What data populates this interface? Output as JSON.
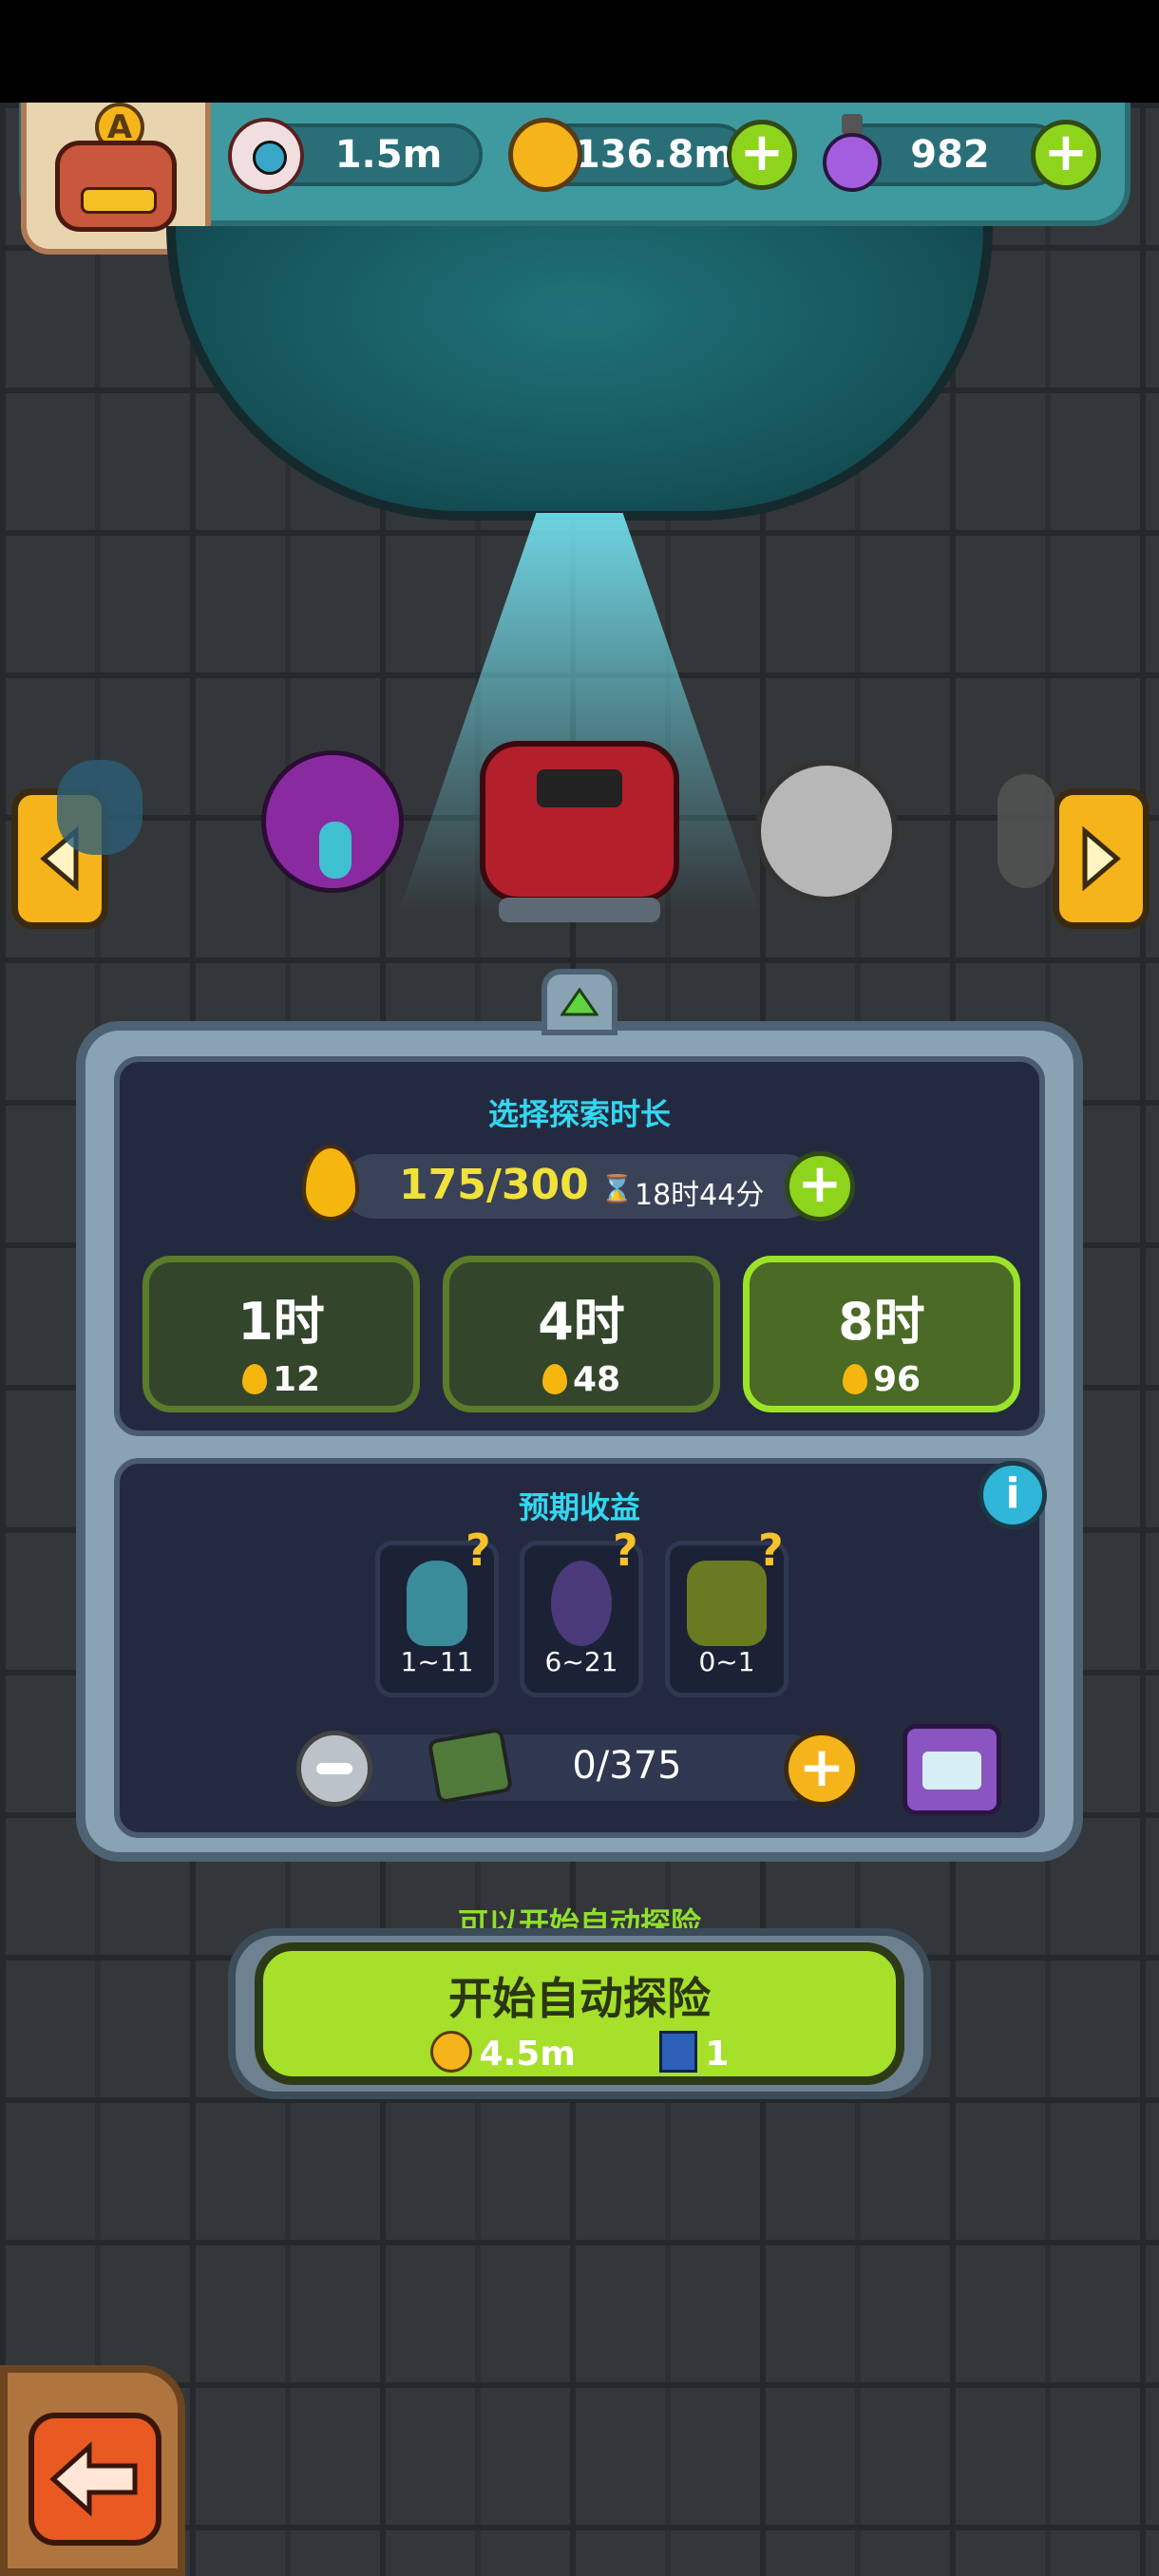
{
  "hud": {
    "rank_letter": "A",
    "eyes": "1.5m",
    "coins": "136.8m",
    "potions": "982"
  },
  "panel": {
    "duration_title": "选择探索时长",
    "energy": "175/300",
    "timer": "18时44分",
    "durations": [
      {
        "label": "1时",
        "cost": "12",
        "selected": false
      },
      {
        "label": "4时",
        "cost": "48",
        "selected": false
      },
      {
        "label": "8时",
        "cost": "96",
        "selected": true
      }
    ],
    "rewards_title": "预期收益",
    "rewards": [
      {
        "range": "1~11",
        "icon": "blue-squid-monster-icon"
      },
      {
        "range": "6~21",
        "icon": "grape-monster-icon"
      },
      {
        "range": "0~1",
        "icon": "green-plant-monster-icon"
      }
    ],
    "tickets": "0/375"
  },
  "start": {
    "status": "可以开始自动探险",
    "label": "开始自动探险",
    "coin_cost": "4.5m",
    "ticket_cost": "1"
  },
  "colors": {
    "accent_green": "#a6e02a",
    "cyan_text": "#33d7f0",
    "gold": "#f5b41a"
  }
}
